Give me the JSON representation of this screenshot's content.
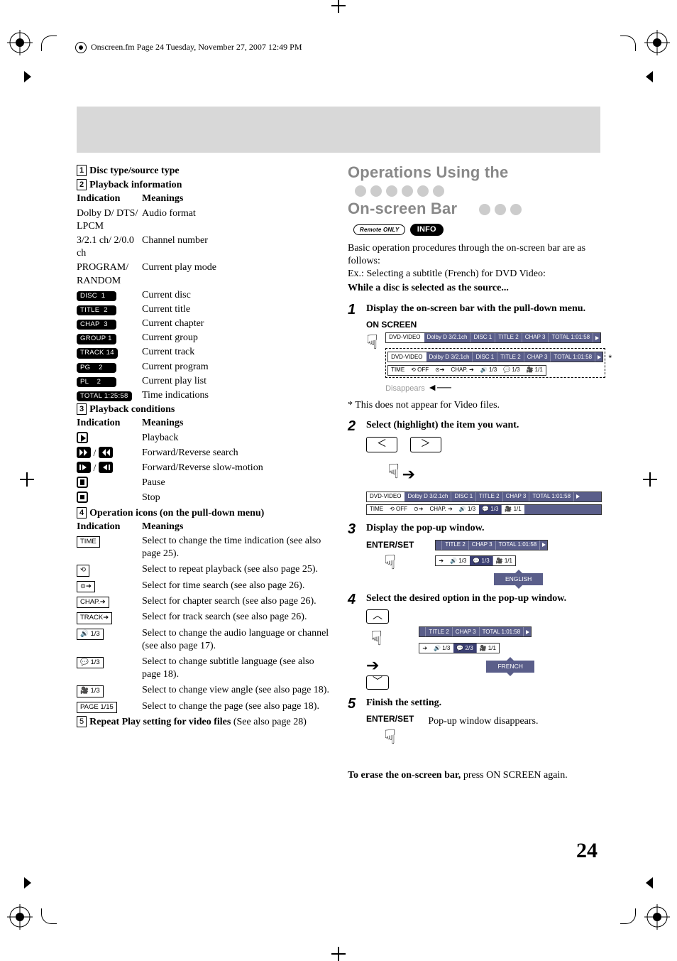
{
  "doc_header": "Onscreen.fm  Page 24  Tuesday, November 27, 2007  12:49 PM",
  "page_number": "24",
  "left": {
    "s1_title": "Disc type/source type",
    "s2_title": "Playback information",
    "hdr_ind": "Indication",
    "hdr_mean": "Meanings",
    "playback_info": [
      {
        "ind": "Dolby D/ DTS/ LPCM",
        "mean": "Audio format",
        "plain": true
      },
      {
        "ind": "3/2.1 ch/ 2/0.0 ch",
        "mean": "Channel number",
        "plain": true
      },
      {
        "ind": "PROGRAM/ RANDOM",
        "mean": "Current play mode",
        "plain": true
      },
      {
        "ind": "DISC  1",
        "mean": "Current disc",
        "chip": true
      },
      {
        "ind": "TITLE  2",
        "mean": "Current title",
        "chip": true
      },
      {
        "ind": "CHAP  3",
        "mean": "Current chapter",
        "chip": true
      },
      {
        "ind": "GROUP 1",
        "mean": "Current group",
        "chip": true
      },
      {
        "ind": "TRACK 14",
        "mean": "Current track",
        "chip": true
      },
      {
        "ind": "PG    2",
        "mean": "Current program",
        "chip": true
      },
      {
        "ind": "PL    2",
        "mean": "Current play list",
        "chip": true
      },
      {
        "ind": "TOTAL 1:25:58",
        "mean": "Time indications",
        "chip": true
      }
    ],
    "s3_title": "Playback conditions",
    "cond": [
      {
        "type": "play",
        "mean": "Playback"
      },
      {
        "type": "ffrw",
        "mean": "Forward/Reverse search"
      },
      {
        "type": "sfsr",
        "mean": "Forward/Reverse slow-motion"
      },
      {
        "type": "pause",
        "mean": "Pause"
      },
      {
        "type": "stop",
        "mean": "Stop"
      }
    ],
    "s4_title": "Operation icons (on the pull-down menu)",
    "ops": [
      {
        "ind": "TIME",
        "mean": "Select to change the time indication (see also page 25)."
      },
      {
        "ind": "⟲",
        "mean": "Select to repeat playback (see also page 25)."
      },
      {
        "ind": "⊙➔",
        "mean": "Select for time search (see also page 26)."
      },
      {
        "ind": "CHAP.➔",
        "mean": "Select for chapter search (see also page 26)."
      },
      {
        "ind": "TRACK➔",
        "mean": "Select for track search (see also page 26)."
      },
      {
        "ind": "🔊 1/3",
        "mean": "Select to change the audio language or channel (see also page 17)."
      },
      {
        "ind": "💬 1/3",
        "mean": "Select to change subtitle language (see also page 18)."
      },
      {
        "ind": "🎥 1/3",
        "mean": "Select to change view angle (see also page 18)."
      },
      {
        "ind": "PAGE 1/15",
        "mean": "Select to change the page (see also page 18)."
      }
    ],
    "s5_prefix": "Repeat Play setting for video files",
    "s5_suffix": " (See also page 28)"
  },
  "right": {
    "title_l1": "Operations Using the",
    "title_l2": "On-screen Bar",
    "remote_badge": "Remote ONLY",
    "info_badge": "INFO",
    "intro1": "Basic operation procedures through the on-screen bar are as follows:",
    "intro2": "Ex.: Selecting a subtitle (French) for DVD Video:",
    "bold_intro": "While a disc is selected as the source...",
    "step1": "Display the on-screen bar with the pull-down menu.",
    "onscreen_label": "ON SCREEN",
    "osd": {
      "dvd": "DVD-VIDEO",
      "dolby": "Dolby D 3/2.1ch",
      "disc": "DISC 1",
      "title": "TITLE  2",
      "chap": "CHAP  3",
      "total": "TOTAL  1:01:58",
      "time": "TIME",
      "off": "⟲ OFF",
      "clock": "⊙➔",
      "chap2": "CHAP. ➔",
      "aud": "🔊 1/3",
      "sub": "💬 1/3",
      "ang": "🎥 1/1"
    },
    "disappears": "Disappears",
    "note_star": "* This does not appear for Video files.",
    "step2": "Select (highlight) the item you want.",
    "step3": "Display the pop-up window.",
    "enter_label": "ENTER/SET",
    "popup_en": "ENGLISH",
    "step4": "Select the desired option in the pop-up window.",
    "popup_fr": "FRENCH",
    "sub23": "💬 2/3",
    "step5": "Finish the setting.",
    "step5_note": "Pop-up window disappears.",
    "erase_bold": "To erase the on-screen bar,",
    "erase_rest": " press ON SCREEN again."
  }
}
